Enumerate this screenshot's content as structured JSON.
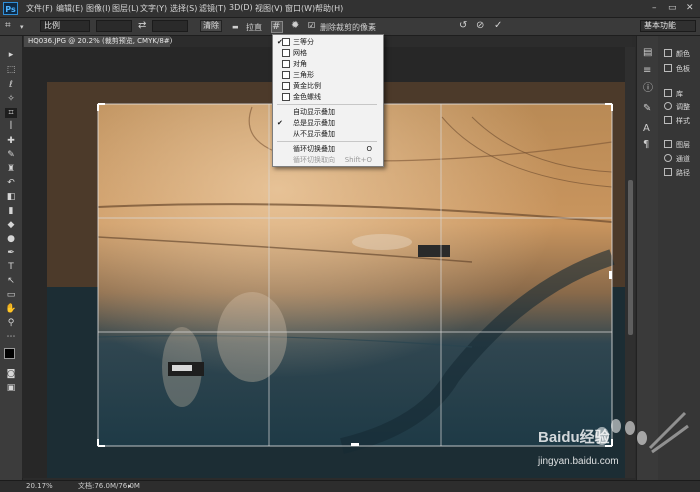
{
  "menubar": {
    "logo": "Ps",
    "items": [
      "文件(F)",
      "编辑(E)",
      "图像(I)",
      "图层(L)",
      "文字(Y)",
      "选择(S)",
      "滤镜(T)",
      "3D(D)",
      "视图(V)",
      "窗口(W)",
      "帮助(H)"
    ]
  },
  "options": {
    "ratio_value": "比例",
    "clear_label": "清除",
    "straighten_label": "拉直",
    "delete_cropped_label": "删除裁剪的像素",
    "workspace": "基本功能"
  },
  "document": {
    "tab_title": "HQ036.JPG @ 20.2% (裁剪预览, CMYK/8#)"
  },
  "overlay_menu": {
    "items": [
      {
        "label": "三等分",
        "checked": true,
        "icon": "thirds-icon"
      },
      {
        "label": "网格",
        "checked": false,
        "icon": "grid-icon"
      },
      {
        "label": "对角",
        "checked": false,
        "icon": "diagonal-icon"
      },
      {
        "label": "三角形",
        "checked": false,
        "icon": "triangle-icon"
      },
      {
        "label": "黄金比例",
        "checked": false,
        "icon": "golden-ratio-icon"
      },
      {
        "label": "金色螺线",
        "checked": false,
        "icon": "golden-spiral-icon"
      }
    ],
    "display_items": [
      {
        "label": "自动显示叠加",
        "checked": false
      },
      {
        "label": "总是显示叠加",
        "checked": true
      },
      {
        "label": "从不显示叠加",
        "checked": false
      }
    ],
    "cycle_label": "循环切换叠加",
    "cycle_shortcut": "O",
    "cycle_orient_label": "循环切换取向",
    "cycle_orient_shortcut": "Shift+O"
  },
  "panels": {
    "items": [
      "颜色",
      "色板",
      "库",
      "调整",
      "样式",
      "图层",
      "通道",
      "路径"
    ]
  },
  "status": {
    "zoom": "20.17%",
    "doc_info": "文档:76.0M/76.0M"
  },
  "watermark": {
    "text": "Baidu经验",
    "url": "jingyan.baidu.com"
  },
  "colors": {
    "accent": "#2f8fd8",
    "app_bg": "#2b2b2b",
    "menu_bg": "#f2f2f2"
  }
}
